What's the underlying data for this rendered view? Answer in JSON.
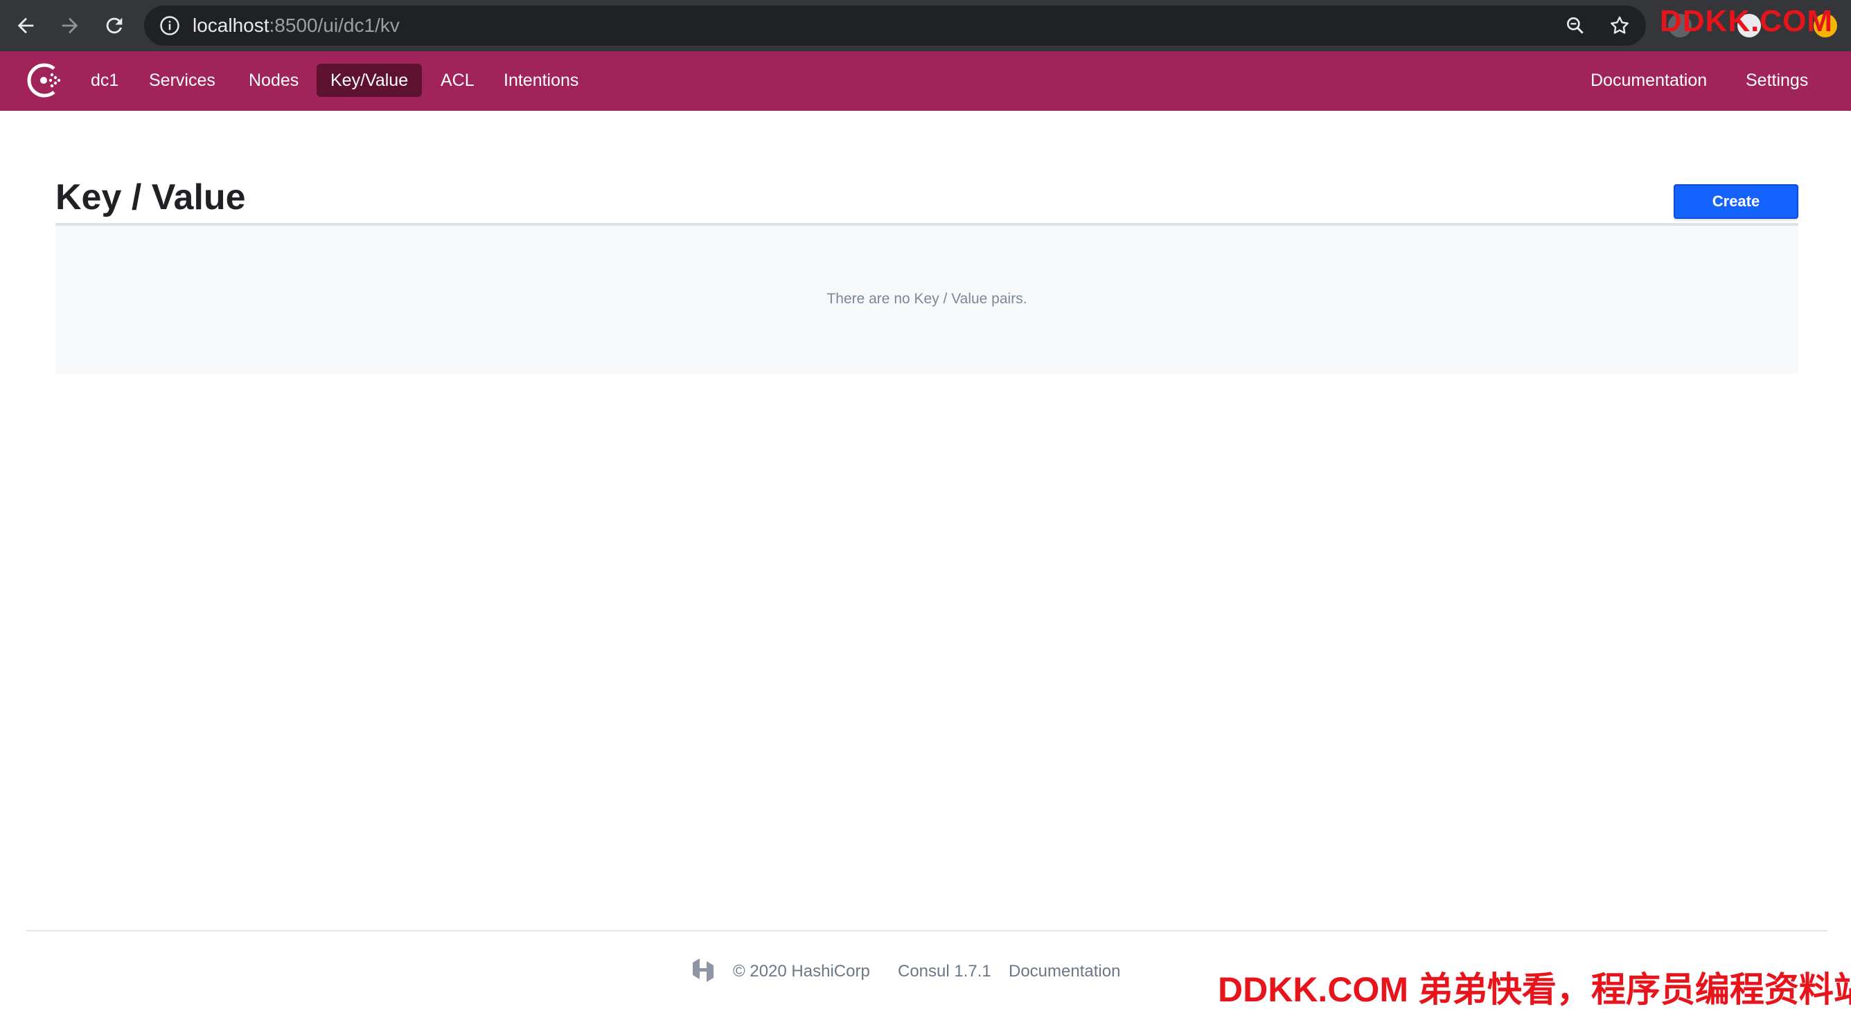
{
  "browser": {
    "url_host": "localhost",
    "url_path": ":8500/ui/dc1/kv",
    "watermark": "DDKK.COM"
  },
  "app": {
    "nav": {
      "datacenter": "dc1",
      "services": "Services",
      "nodes": "Nodes",
      "key_value": "Key/Value",
      "acl": "ACL",
      "intentions": "Intentions",
      "documentation": "Documentation",
      "settings": "Settings"
    },
    "accent_color": "#a0245a",
    "active_nav_color": "#5e1230"
  },
  "main": {
    "title": "Key / Value",
    "create_label": "Create",
    "empty_message": "There are no Key / Value pairs.",
    "button_color": "#1563ff"
  },
  "footer": {
    "copyright": "© 2020 HashiCorp",
    "version": "Consul 1.7.1",
    "documentation": "Documentation",
    "watermark": "DDKK.COM 弟弟快看，程序员编程资料站"
  }
}
